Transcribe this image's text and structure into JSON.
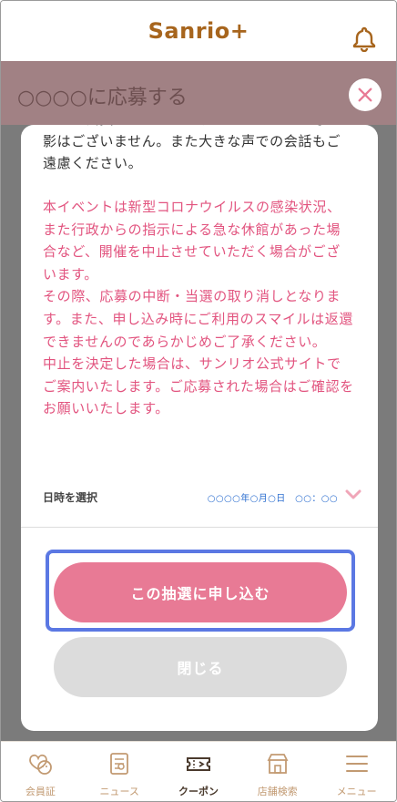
{
  "header": {
    "logo": "Sanrio+",
    "bell_icon": "bell-icon"
  },
  "page": {
    "title": "○○○○に応募する",
    "close_icon": "close-icon"
  },
  "modal": {
    "notice_black": "影はございません。また大きな声での会話もご遠慮ください。",
    "notice_pink": [
      "本イベントは新型コロナウイルスの感染状況、また行政からの指示による急な休館があった場合など、開催を中止させていただく場合がございます。",
      "その際、応募の中断・当選の取り消しとなります。また、申し込み時にご利用のスマイルは返還できませんのであらかじめご了承ください。",
      "中止を決定した場合は、サンリオ公式サイトでご案内いたします。ご応募された場合はご確認をお願いいたします。"
    ],
    "date_label": "日時を選択",
    "date_value": "○○○○年○月○日　○○：○○",
    "apply_button": "この抽選に申し込む",
    "close_button": "閉じる"
  },
  "tabbar": {
    "items": [
      {
        "label": "会員証",
        "icon": "member-card-icon",
        "active": false
      },
      {
        "label": "ニュース",
        "icon": "news-icon",
        "active": false
      },
      {
        "label": "クーポン",
        "icon": "coupon-icon",
        "active": true
      },
      {
        "label": "店舗検索",
        "icon": "store-search-icon",
        "active": false
      },
      {
        "label": "メニュー",
        "icon": "menu-icon",
        "active": false
      }
    ]
  },
  "colors": {
    "brand": "#a7651d",
    "pink_text": "#e2547f",
    "apply_button": "#e87a95",
    "highlight": "#5b78e3",
    "tab_inactive": "#c29a72"
  }
}
